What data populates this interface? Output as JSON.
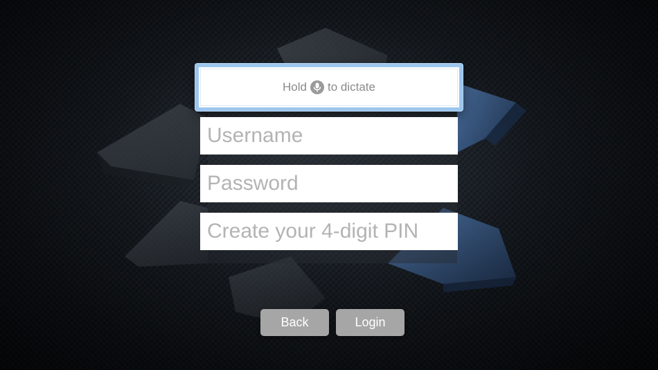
{
  "dictation": {
    "hold_label": "Hold",
    "icon": "microphone-icon",
    "dictate_label": "to dictate"
  },
  "fields": {
    "username_placeholder": "Username",
    "password_placeholder": "Password",
    "pin_placeholder": "Create your 4-digit PIN"
  },
  "buttons": {
    "back_label": "Back",
    "login_label": "Login"
  },
  "colors": {
    "focus_border": "#9cc6ee",
    "button_bg": "#a6a6a6",
    "logo_blue": "#3d5f8f",
    "background": "#10151a"
  }
}
